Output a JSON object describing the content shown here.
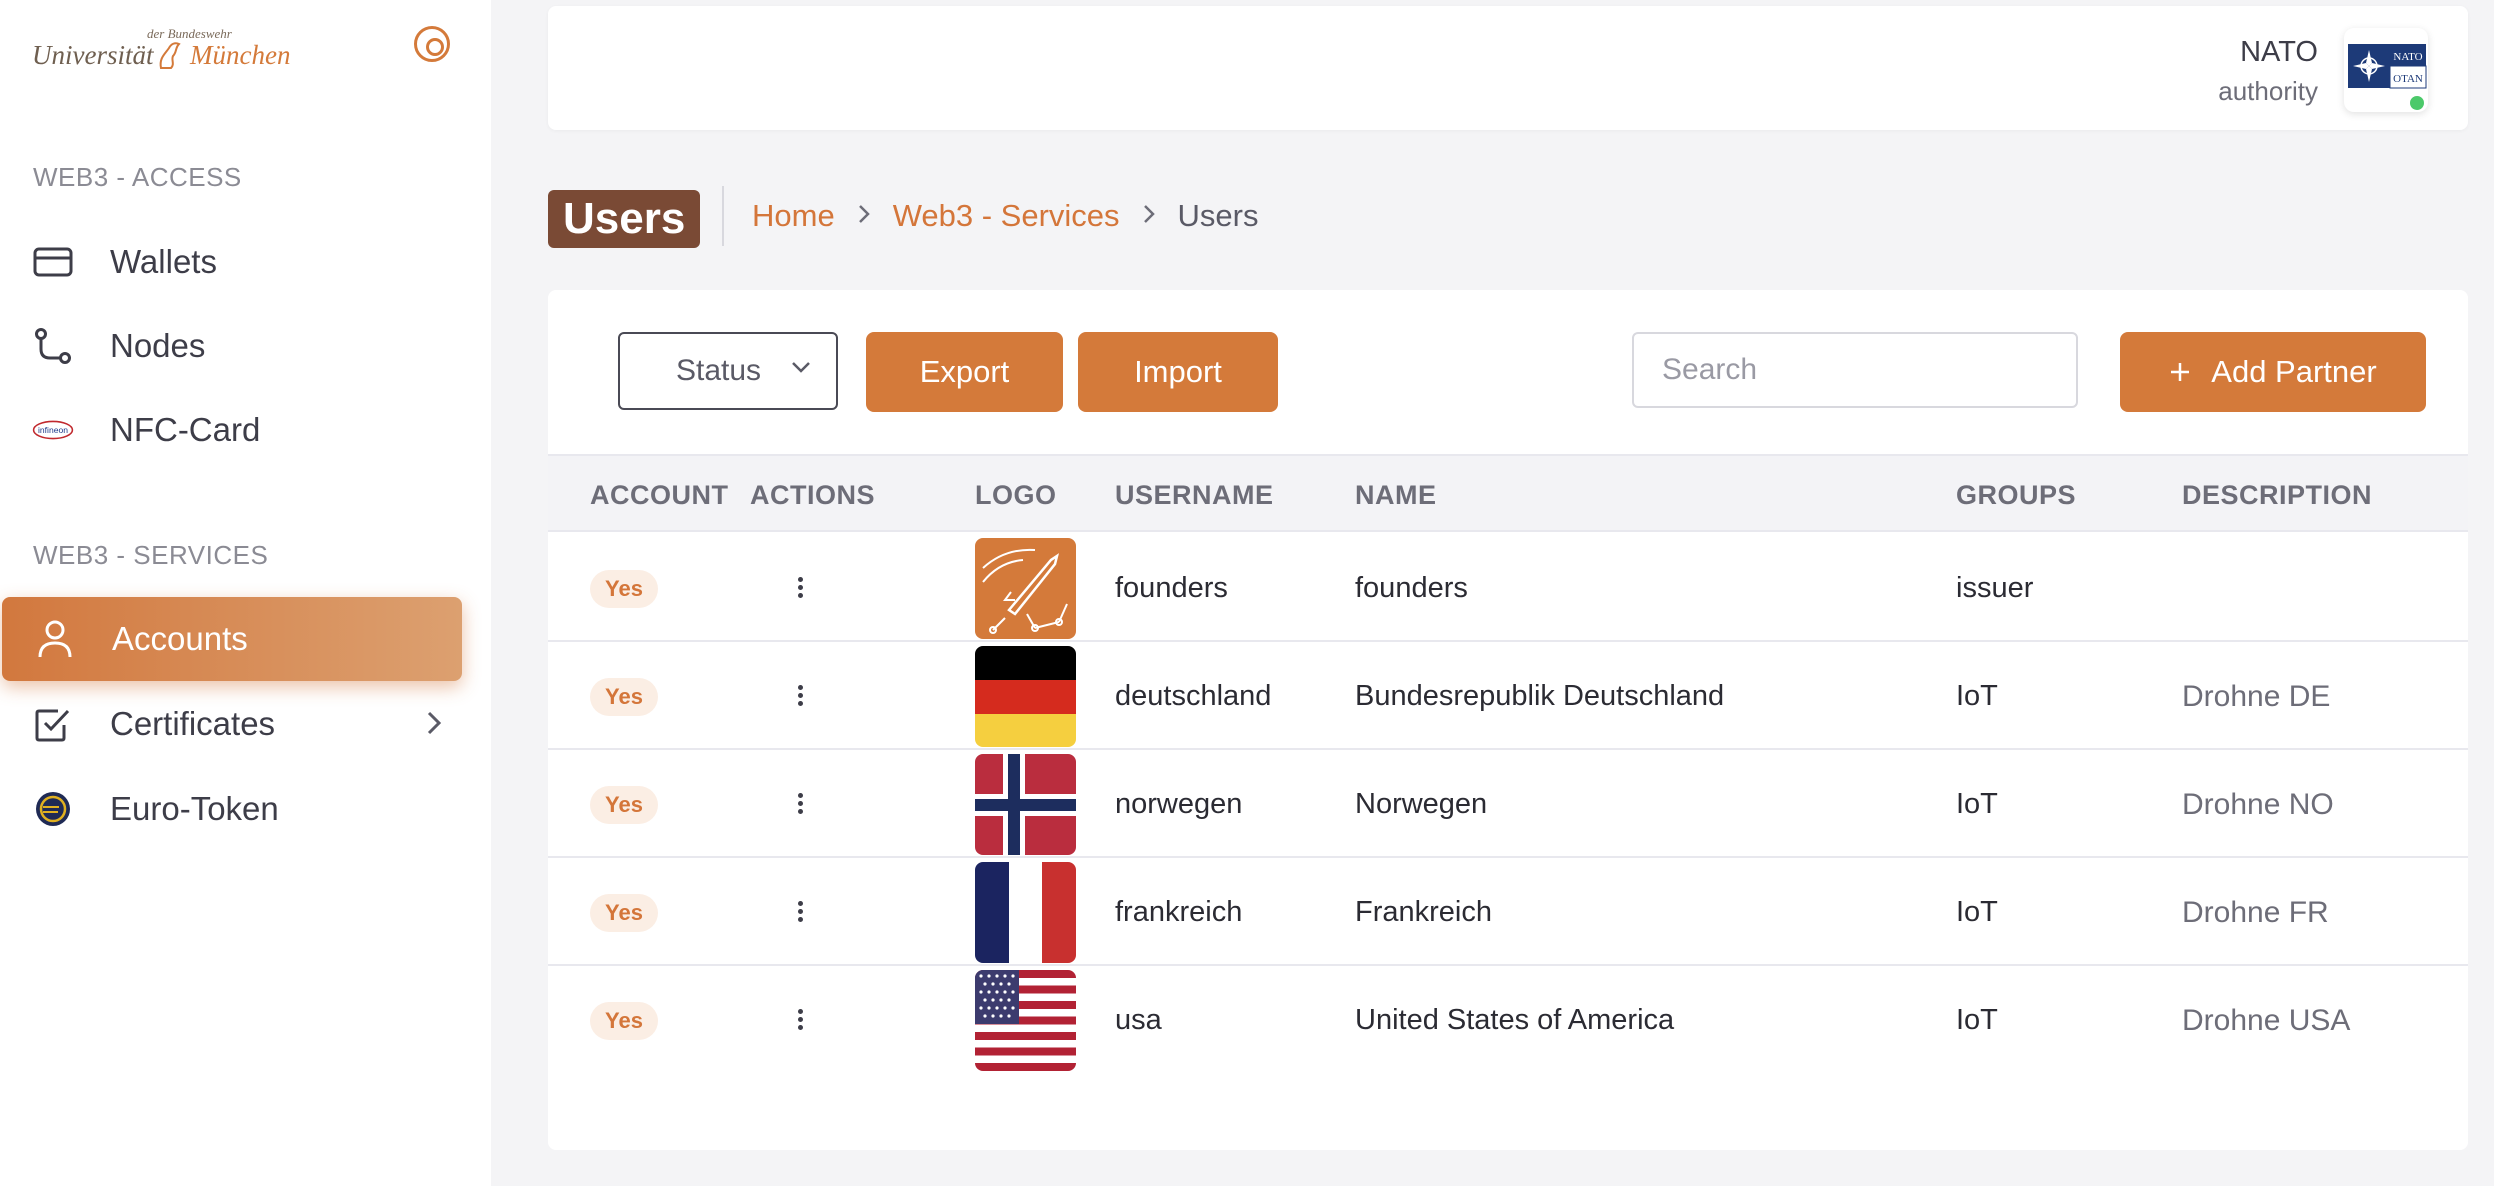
{
  "sidebar": {
    "logo": {
      "small_text": "der Bundeswehr",
      "university": "Universität",
      "city": "München"
    },
    "sections": [
      {
        "label": "WEB3 - ACCESS",
        "items": [
          {
            "label": "Wallets",
            "icon": "wallet-icon"
          },
          {
            "label": "Nodes",
            "icon": "nodes-icon"
          },
          {
            "label": "NFC-Card",
            "icon": "infineon-icon"
          }
        ]
      },
      {
        "label": "WEB3 - SERVICES",
        "items": [
          {
            "label": "Accounts",
            "icon": "user-icon",
            "active": true
          },
          {
            "label": "Certificates",
            "icon": "checkbox-icon"
          },
          {
            "label": "Euro-Token",
            "icon": "euro-token-icon"
          }
        ]
      }
    ]
  },
  "header": {
    "user_name": "NATO",
    "user_role": "authority",
    "avatar_text_top": "NATO",
    "avatar_text_bottom": "OTAN"
  },
  "page": {
    "title": "Users",
    "breadcrumb": [
      "Home",
      "Web3 - Services",
      "Users"
    ]
  },
  "toolbar": {
    "status_label": "Status",
    "export_label": "Export",
    "import_label": "Import",
    "search_placeholder": "Search",
    "add_label": "Add Partner"
  },
  "table": {
    "columns": [
      "ACCOUNT",
      "ACTIONS",
      "LOGO",
      "USERNAME",
      "NAME",
      "GROUPS",
      "DESCRIPTION"
    ],
    "rows": [
      {
        "account": "Yes",
        "logo": "founders-rocket",
        "username": "founders",
        "name": "founders",
        "groups": "issuer",
        "description": ""
      },
      {
        "account": "Yes",
        "logo": "flag-de",
        "username": "deutschland",
        "name": "Bundesrepublik Deutschland",
        "groups": "IoT",
        "description": "Drohne DE"
      },
      {
        "account": "Yes",
        "logo": "flag-no",
        "username": "norwegen",
        "name": "Norwegen",
        "groups": "IoT",
        "description": "Drohne NO"
      },
      {
        "account": "Yes",
        "logo": "flag-fr",
        "username": "frankreich",
        "name": "Frankreich",
        "groups": "IoT",
        "description": "Drohne FR"
      },
      {
        "account": "Yes",
        "logo": "flag-us",
        "username": "usa",
        "name": "United States of America",
        "groups": "IoT",
        "description": "Drohne USA"
      }
    ]
  },
  "colors": {
    "accent": "#d47a3a",
    "title_badge": "#7a4a35",
    "online": "#4cc96a"
  }
}
